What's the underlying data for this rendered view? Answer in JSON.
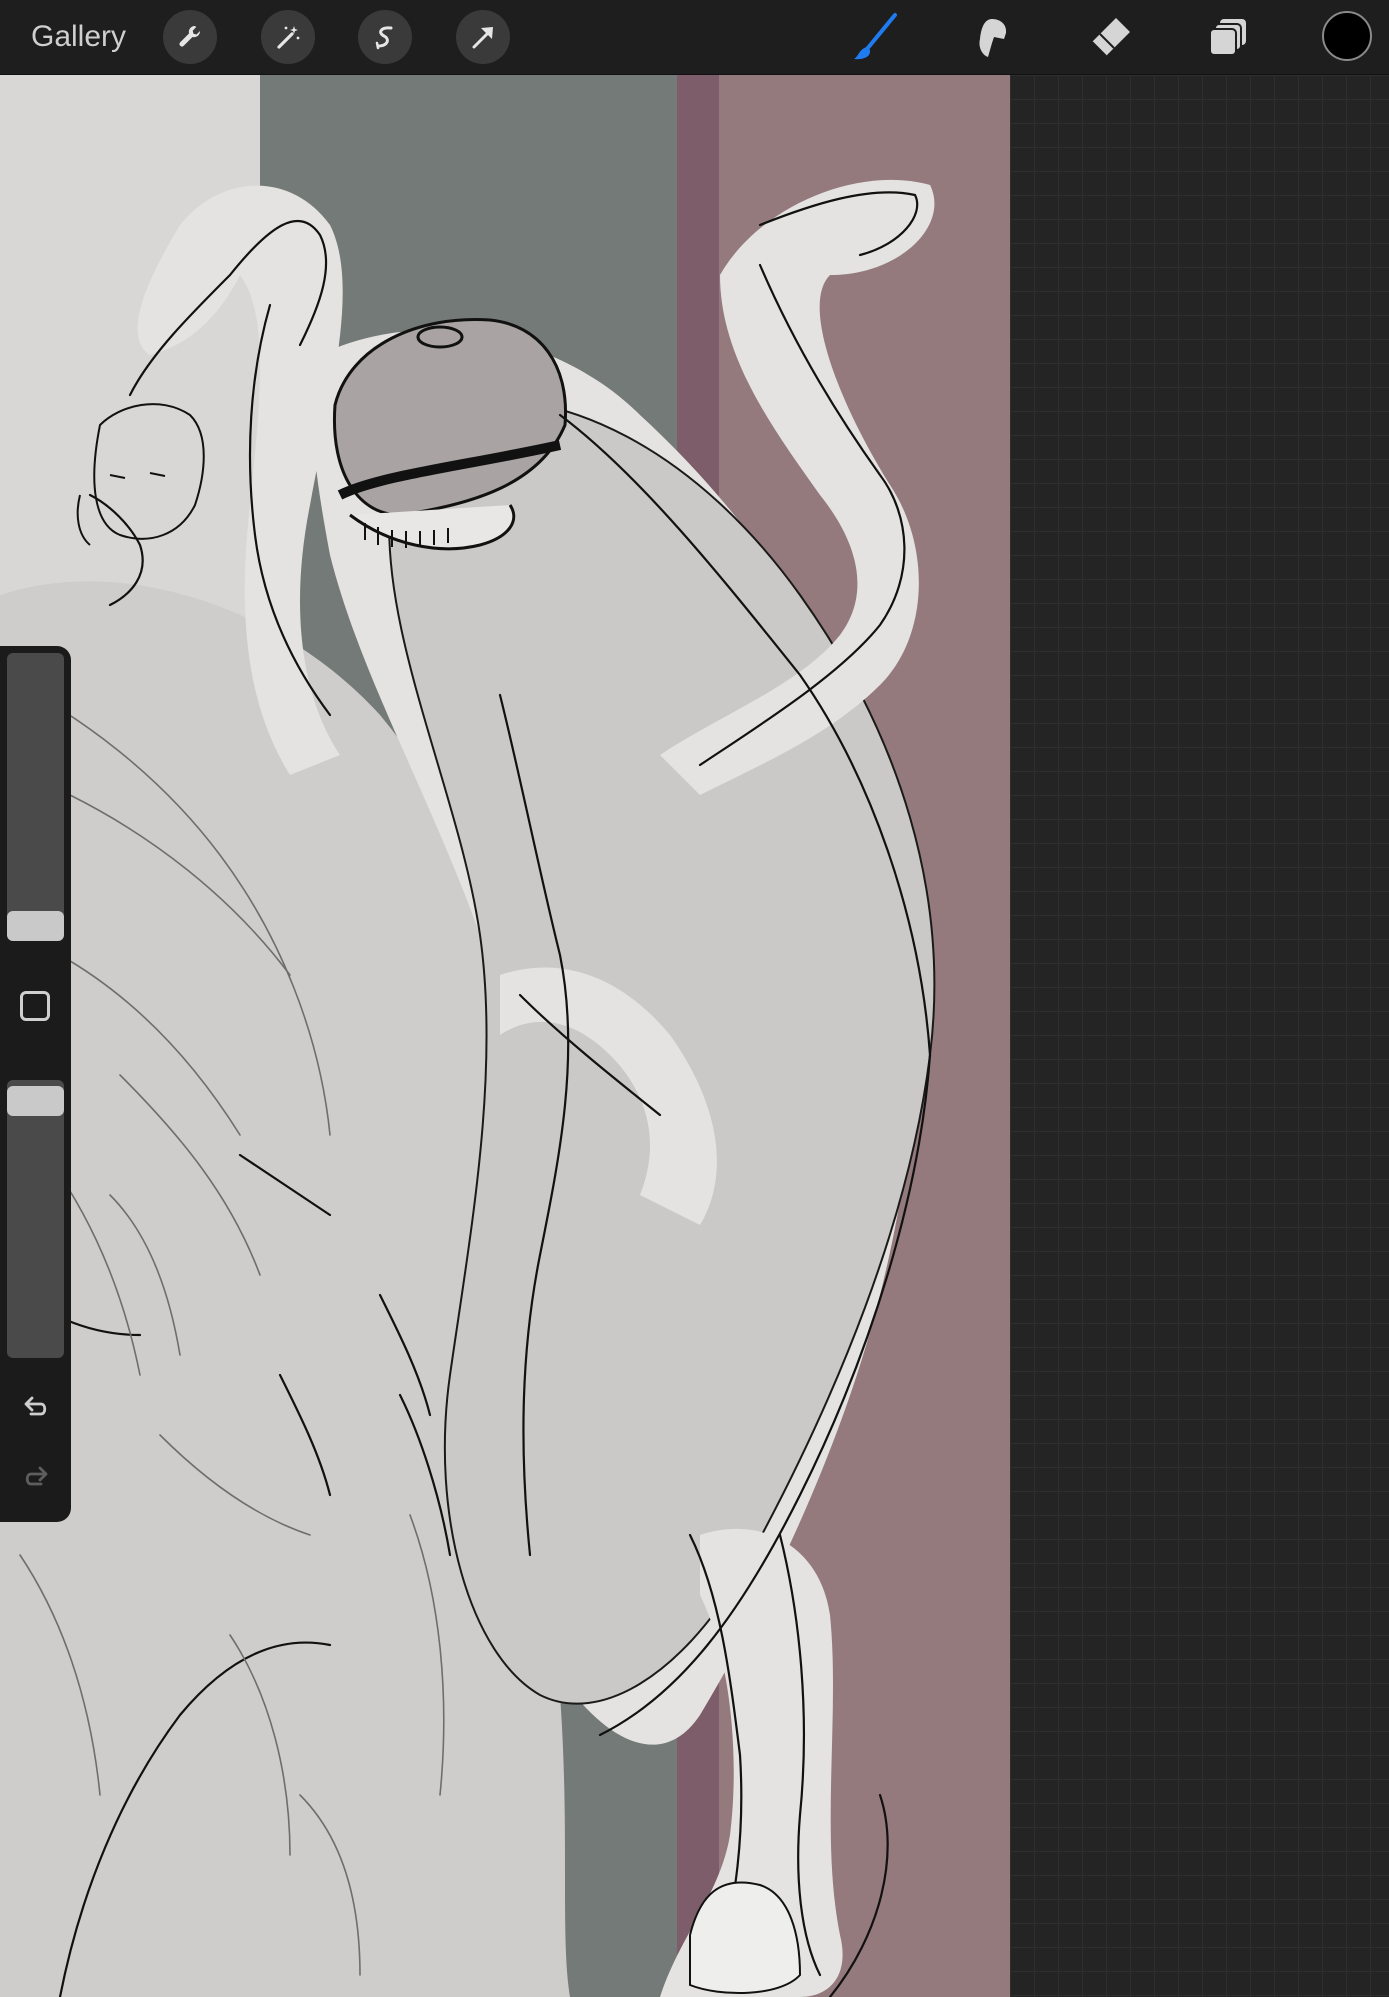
{
  "toolbar": {
    "gallery_label": "Gallery",
    "left_tools": [
      "wrench-icon",
      "magic-wand-icon",
      "selection-icon",
      "transform-arrow-icon"
    ],
    "right_tools": [
      "brush-icon",
      "smudge-icon",
      "eraser-icon",
      "layers-icon"
    ],
    "active_tool": "brush-icon",
    "active_color": "#000000",
    "accent_color": "#1e7cf0"
  },
  "sidebar": {
    "brush_size_level": 0.15,
    "opacity_level": 0.95,
    "icons": [
      "modify-square-icon",
      "undo-icon",
      "redo-icon"
    ]
  },
  "canvas": {
    "background_colors": [
      "#d9d7d5",
      "#747a78",
      "#7d5d6a",
      "#947a7c",
      "#cfcdcb"
    ]
  }
}
